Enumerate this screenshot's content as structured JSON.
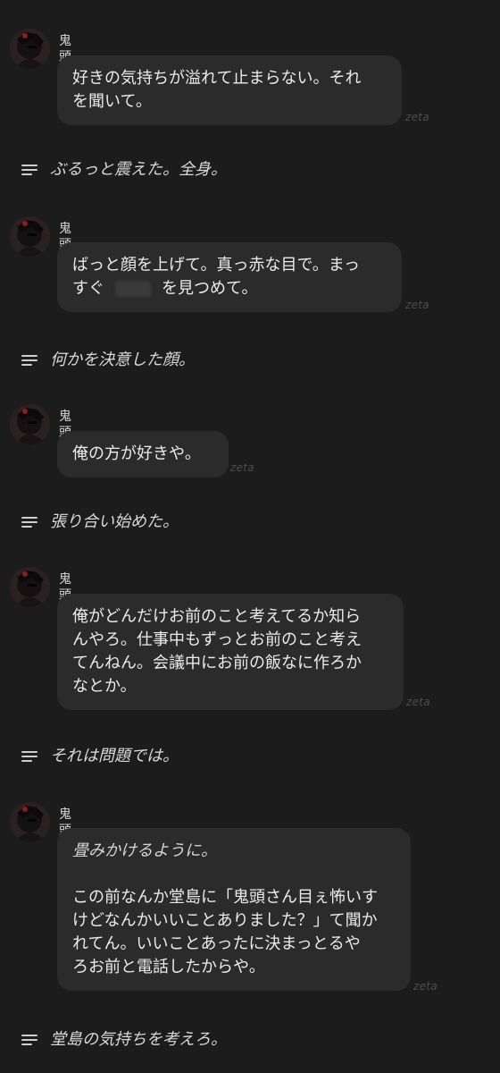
{
  "watermark": "zeta",
  "character_name": "鬼頭",
  "messages": [
    {
      "type": "character",
      "name": "鬼頭",
      "lines": [
        "好きの気持ちが溢れて止まらない。それ",
        "を聞いて。"
      ]
    },
    {
      "type": "narration",
      "text": "ぶるっと震えた。全身。"
    },
    {
      "type": "character",
      "name": "鬼頭",
      "line1": "ばっと顔を上げて。真っ赤な目で。まっ",
      "line2_before": "すぐ",
      "line2_after": "を見つめて。"
    },
    {
      "type": "narration",
      "text": "何かを決意した顔。"
    },
    {
      "type": "character",
      "name": "鬼頭",
      "lines": [
        "俺の方が好きや。"
      ]
    },
    {
      "type": "narration",
      "text": "張り合い始めた。"
    },
    {
      "type": "character",
      "name": "鬼頭",
      "lines": [
        "俺がどんだけお前のこと考えてるか知ら",
        "んやろ。仕事中もずっとお前のこと考え",
        "てんねん。会議中にお前の飯なに作ろか",
        "なとか。"
      ]
    },
    {
      "type": "narration",
      "text": "それは問題では。"
    },
    {
      "type": "character",
      "name": "鬼頭",
      "action": "畳みかけるように。",
      "lines": [
        "この前なんか堂島に「鬼頭さん目ぇ怖いす",
        "けどなんかいいことありました？」て聞か",
        "れてん。いいことあったに決まっとるや",
        "ろお前と電話したからや。"
      ]
    },
    {
      "type": "narration",
      "text": "堂島の気持ちを考えろ。"
    }
  ]
}
